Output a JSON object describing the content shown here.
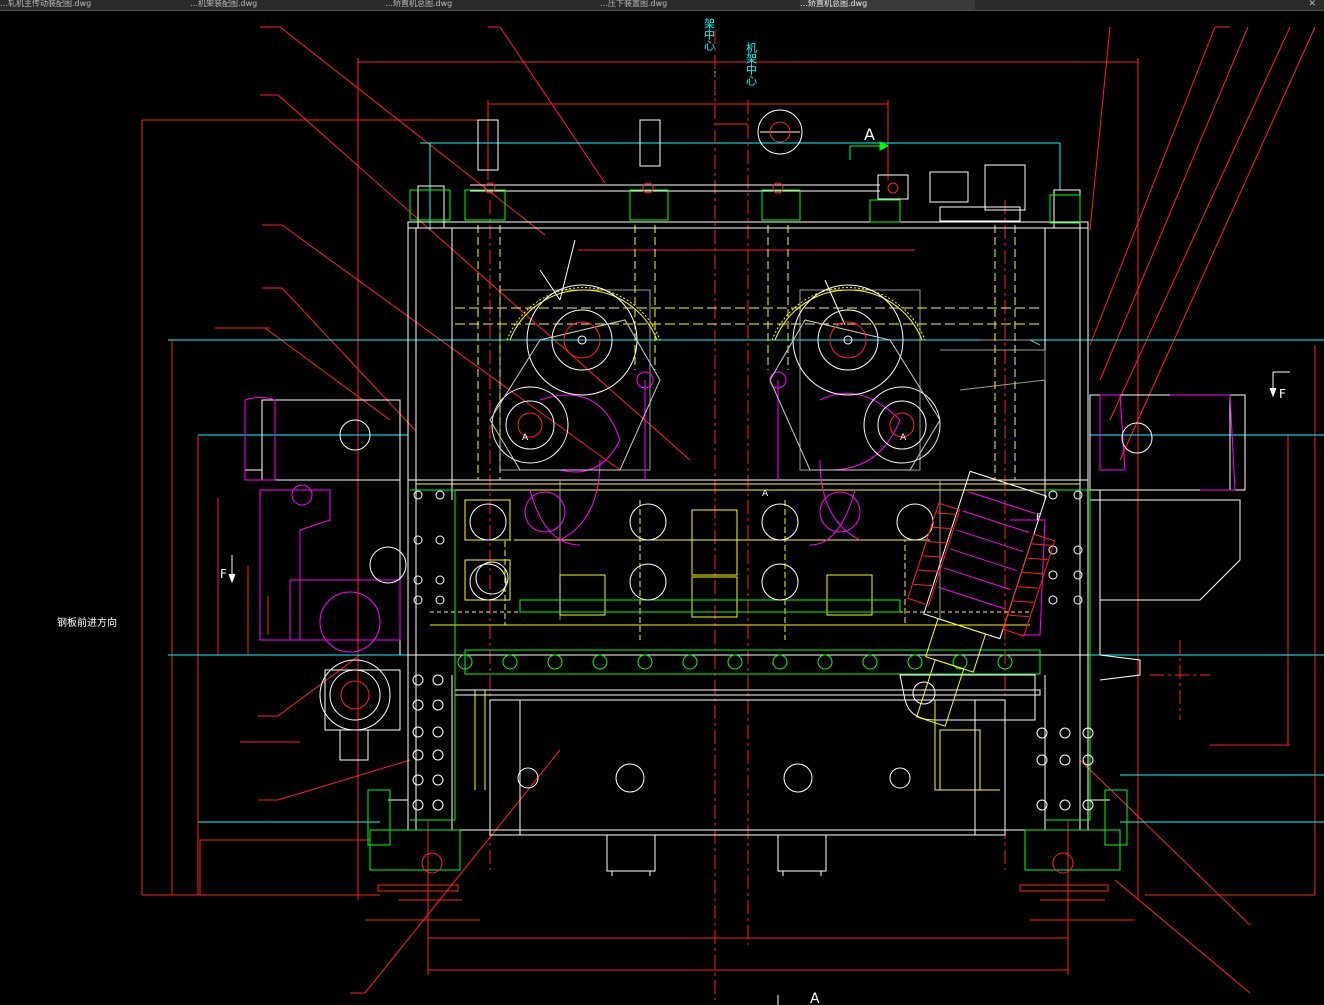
{
  "tabs": [
    {
      "label": "…轧机主传动装配图.dwg"
    },
    {
      "label": "…机架装配图.dwg"
    },
    {
      "label": "…矫直机总图.dwg"
    },
    {
      "label": "…压下装置图.dwg"
    },
    {
      "label": "…矫直机总图.dwg",
      "active": true
    }
  ],
  "annotations": {
    "center_label_1": "架中心",
    "center_label_2": "机架中心",
    "view_a_top": "A",
    "view_a_bottom": "A",
    "view_f_left": "F",
    "view_f_right": "F",
    "steel_direction": "钢板前进方向",
    "mark_a_left": "A",
    "mark_a_mid": "A",
    "mark_a_right": "A",
    "mark_f_mid": "F"
  },
  "colors": {
    "background": "#000000",
    "white": "#ffffff",
    "red": "#ff2020",
    "yellow": "#ffff00",
    "green": "#00ff00",
    "cyan": "#00ffff",
    "magenta": "#ff00ff",
    "gray": "#9a9a9a"
  }
}
